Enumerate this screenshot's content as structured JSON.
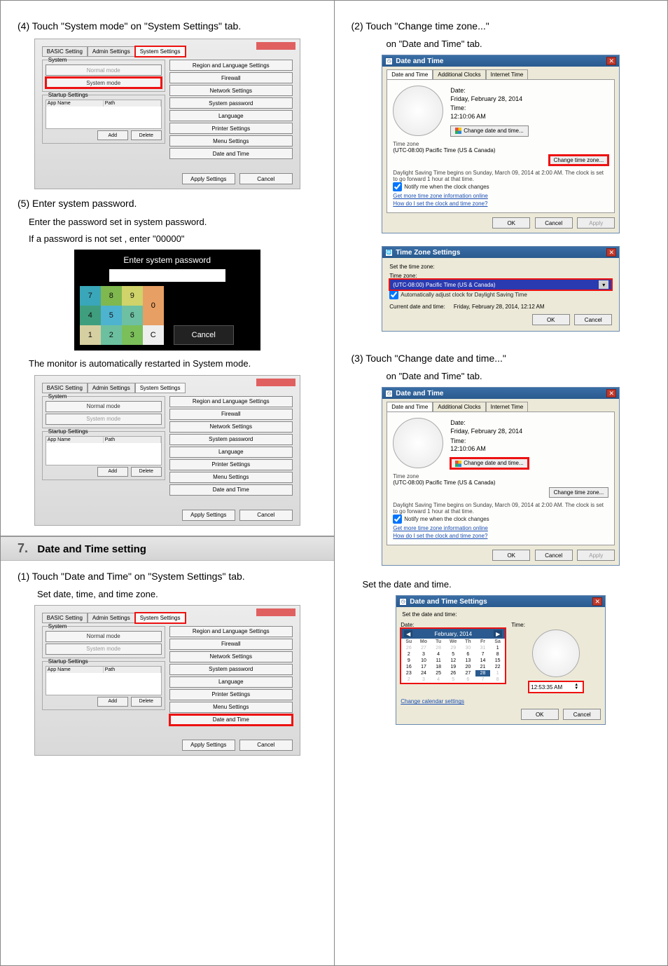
{
  "left": {
    "step4": "(4) Touch \"System mode\" on \"System Settings\" tab.",
    "tabs": {
      "basic": "BASIC Setting",
      "admin": "Admin Settings",
      "system": "System Settings"
    },
    "group_system": "System",
    "mode_normal": "Normal mode",
    "mode_system": "System mode",
    "group_startup": "Startup Settings",
    "col_appname": "App Name",
    "col_path": "Path",
    "btn_add": "Add",
    "btn_delete": "Delete",
    "right_buttons": {
      "region": "Region and Language Settings",
      "firewall": "Firewall",
      "network": "Network Settings",
      "syspw": "System password",
      "language": "Language",
      "printer": "Printer Settings",
      "menu": "Menu Settings",
      "datetime": "Date and Time"
    },
    "btn_apply": "Apply Settings",
    "btn_cancel": "Cancel",
    "step5": "(5) Enter system password.",
    "step5_desc1": "Enter the password set in system password.",
    "step5_desc2": "If a password is not set , enter \"00000\"",
    "pwd_title": "Enter system password",
    "pwd_cancel": "Cancel",
    "keys": {
      "k0": "0",
      "k1": "1",
      "k2": "2",
      "k3": "3",
      "k4": "4",
      "k5": "5",
      "k6": "6",
      "k7": "7",
      "k8": "8",
      "k9": "9",
      "kc": "C"
    },
    "after": "The monitor is automatically restarted in System mode.",
    "section_num": "7.",
    "section_title": "Date and Time setting",
    "step7_1": "(1) Touch \"Date and Time\" on \"System Settings\" tab.",
    "step7_1_sub": "Set date, time, and time zone."
  },
  "right": {
    "step2": "(2) Touch \"Change time zone...\"",
    "step2_sub": "on \"Date and Time\" tab.",
    "dt_title": "Date and Time",
    "tab_datetime": "Date and Time",
    "tab_addclocks": "Additional Clocks",
    "tab_internet": "Internet Time",
    "date_lbl": "Date:",
    "date_val": "Friday, February 28, 2014",
    "time_lbl": "Time:",
    "time_val": "12:10:06 AM",
    "btn_change_dt": "Change date and time...",
    "tz_lbl": "Time zone",
    "tz_val": "(UTC-08:00) Pacific Time (US & Canada)",
    "btn_change_tz": "Change time zone...",
    "dst_note": "Daylight Saving Time begins on Sunday, March 09, 2014 at 2:00 AM. The clock is set to go forward 1 hour at that time.",
    "notify": "Notify me when the clock changes",
    "link_info": "Get more time zone information online",
    "link_how": "How do I set the clock and time zone?",
    "btn_ok": "OK",
    "btn_cancel": "Cancel",
    "btn_apply": "Apply",
    "tzwin_title": "Time Zone Settings",
    "tzwin_set": "Set the time zone:",
    "tzwin_zone": "Time zone:",
    "tzwin_auto": "Automatically adjust clock for Daylight Saving Time",
    "tzwin_curr_lbl": "Current date and time:",
    "tzwin_curr_val": "Friday, February 28, 2014, 12:12 AM",
    "step3": "(3) Touch \"Change date and time...\"",
    "step3_sub": "on \"Date and Time\" tab.",
    "set_caption": "Set the date and time.",
    "dts_title": "Date and Time Settings",
    "dts_set": "Set the date and time:",
    "dts_date": "Date:",
    "dts_time": "Time:",
    "dts_month": "February, 2014",
    "dts_days": [
      "Su",
      "Mo",
      "Tu",
      "We",
      "Th",
      "Fr",
      "Sa"
    ],
    "dts_grid": [
      [
        "26",
        "27",
        "28",
        "29",
        "30",
        "31",
        "1"
      ],
      [
        "2",
        "3",
        "4",
        "5",
        "6",
        "7",
        "8"
      ],
      [
        "9",
        "10",
        "11",
        "12",
        "13",
        "14",
        "15"
      ],
      [
        "16",
        "17",
        "18",
        "19",
        "20",
        "21",
        "22"
      ],
      [
        "23",
        "24",
        "25",
        "26",
        "27",
        "28",
        "1"
      ],
      [
        "2",
        "3",
        "4",
        "5",
        "6",
        "7",
        "8"
      ]
    ],
    "dts_sel_row": 4,
    "dts_sel_col": 5,
    "dts_timeval": "12:53:35 AM",
    "link_calendar": "Change calendar settings"
  }
}
